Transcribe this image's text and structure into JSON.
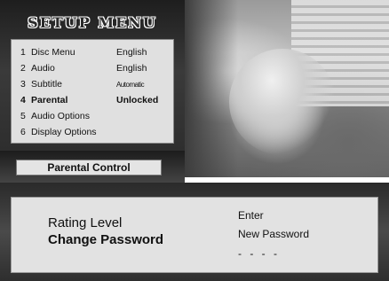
{
  "menu": {
    "title": "SETUP MENU",
    "items": [
      {
        "num": "1",
        "label": "Disc Menu",
        "value": "English",
        "selected": false
      },
      {
        "num": "2",
        "label": "Audio",
        "value": "English",
        "selected": false
      },
      {
        "num": "3",
        "label": "Subtitle",
        "value": "Automatic",
        "selected": false
      },
      {
        "num": "4",
        "label": "Parental",
        "value": "Unlocked",
        "selected": true
      },
      {
        "num": "5",
        "label": "Audio Options",
        "value": "",
        "selected": false
      },
      {
        "num": "6",
        "label": "Display Options",
        "value": "",
        "selected": false
      }
    ]
  },
  "section": {
    "label": "Parental Control"
  },
  "parental": {
    "rating_label": "Rating Level",
    "change_password_label": "Change Password",
    "prompt_line1": "Enter",
    "prompt_line2": "New Password",
    "password_mask": "- - - -"
  }
}
